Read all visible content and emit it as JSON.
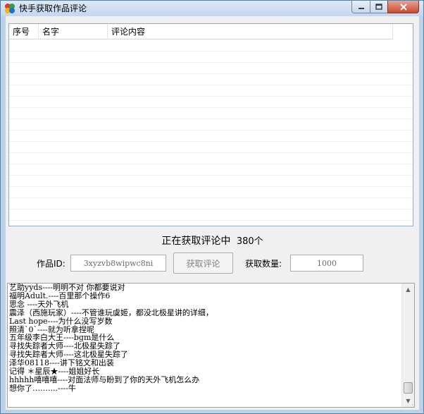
{
  "window": {
    "title": "快手获取作品评论",
    "icon": "app-logo-icon",
    "controls": [
      "minimize-icon",
      "maximize-icon",
      "close-icon"
    ]
  },
  "list": {
    "columns": [
      "序号",
      "名字",
      "评论内容"
    ],
    "rows": []
  },
  "status": {
    "text": "正在获取评论中",
    "count": "380个"
  },
  "form": {
    "id_label": "作品ID:",
    "id_value": "3xyzvb8wipwc8ni",
    "fetch_button": "获取评论",
    "count_label": "获取数量:",
    "count_value": "1000"
  },
  "log": {
    "lines": [
      "艺助yyds----明明不对 你都要说对",
      "福明Adult.----百里那个操作6",
      "思念 ----天外飞机",
      "震泽（西施玩家）----不管谁玩虞姬，都没北极星讲的详细，",
      "Last hope----为什么没写岁数",
      "照清`0`----就为听拿捏呢",
      "五年级李白大王----bgm是什么",
      "寻找失踪者大师----北极星失踪了",
      "寻找失踪者大师----这北极星失踪了",
      "泽华08118----讲下铭文和出装",
      "记得 ＊星辰★----姐姐好长",
      "hhhhh嘻嘻嘻----对面法师与盼到了你的天外飞机怎么办",
      "想你了……....----牛"
    ]
  },
  "colors": {
    "frame": "#b9d1ea",
    "client": "#f0f0f0",
    "close_button": "#c7482f"
  }
}
